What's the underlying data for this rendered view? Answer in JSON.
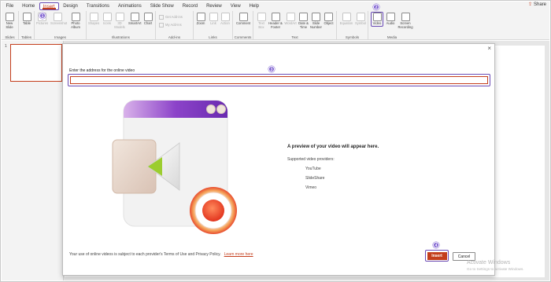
{
  "menu": {
    "items": [
      "File",
      "Home",
      "Insert",
      "Design",
      "Transitions",
      "Animations",
      "Slide Show",
      "Record",
      "Review",
      "View",
      "Help"
    ],
    "active": "Insert",
    "share_label": "Share"
  },
  "ribbon": {
    "groups": {
      "slides": "Slides",
      "tables": "Tables",
      "images": "Images",
      "illustrations": "Illustrations",
      "addins": "Add-ins",
      "links": "Links",
      "comments": "Comments",
      "text": "Text",
      "symbols": "Symbols",
      "media": "Media"
    },
    "buttons": {
      "new_slide": "New Slide",
      "table": "Table",
      "pictures": "Pictures",
      "screenshot": "Screenshot",
      "photo_album": "Photo Album",
      "shapes": "Shapes",
      "icons": "Icons",
      "models": "3D Models",
      "smartart": "SmartArt",
      "chart": "Chart",
      "get_addins": "Get Add-ins",
      "my_addins": "My Add-ins",
      "zoom": "Zoom",
      "link": "Link",
      "action": "Action",
      "comment": "Comment",
      "text_box": "Text Box",
      "header_footer": "Header & Footer",
      "wordart": "WordArt",
      "date_time": "Date & Time",
      "slide_number": "Slide Number",
      "object": "Object",
      "equation": "Equation",
      "symbol": "Symbol",
      "video": "Video",
      "audio": "Audio",
      "screen_recording": "Screen Recording"
    }
  },
  "steps": [
    "1",
    "2",
    "3",
    "4"
  ],
  "thumbnails": {
    "number": "1"
  },
  "dialog": {
    "close_glyph": "×",
    "address_label": "Enter the address for the online video",
    "address_value": "",
    "preview_title": "A preview of your video will appear here.",
    "providers_label": "Supported video providers:",
    "providers": [
      "YouTube",
      "SlideShare",
      "Vimeo"
    ],
    "footer_text": "Your use of online videos is subject to each provider's Terms of Use and Privacy Policy.",
    "learn_more": "Learn more here",
    "insert_label": "Insert",
    "cancel_label": "Cancel"
  },
  "watermark": {
    "title": "Activate Windows",
    "subtitle": "Go to Settings to activate Windows."
  },
  "colors": {
    "accent": "#c43e1c",
    "highlight": "#6a4bb5",
    "badge": "#7d5fd0"
  }
}
